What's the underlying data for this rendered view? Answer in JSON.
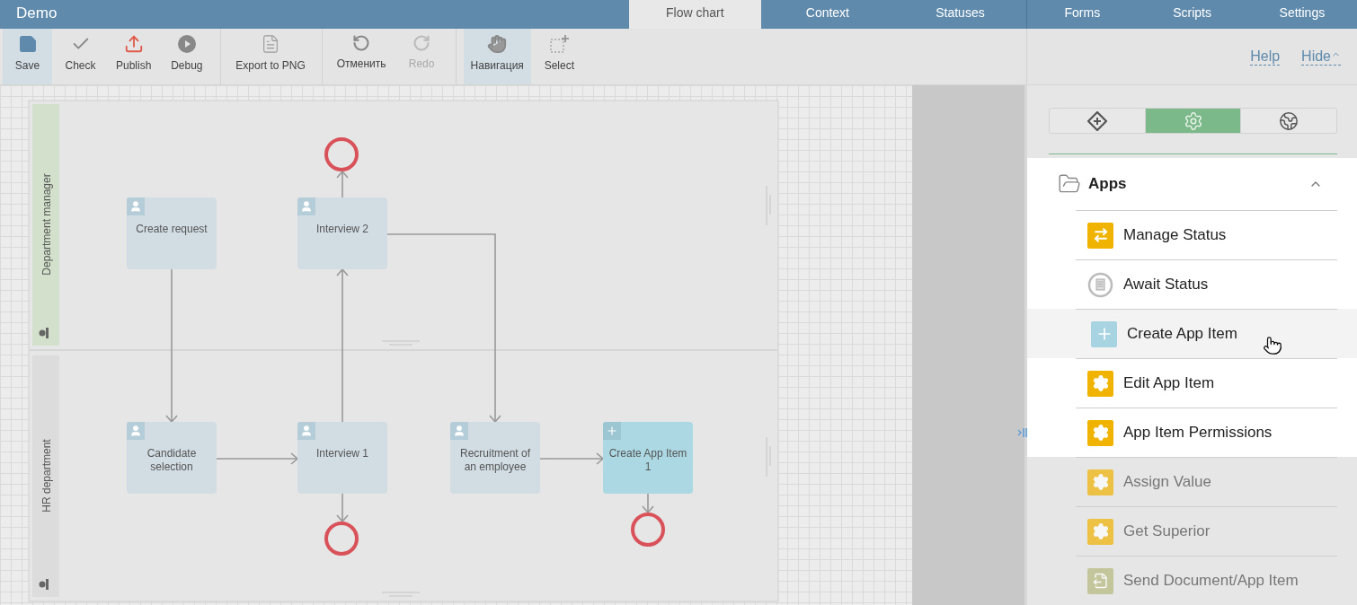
{
  "app": {
    "title": "Demo"
  },
  "tabs": [
    {
      "label": "Flow chart",
      "selected": true
    },
    {
      "label": "Context",
      "selected": false
    },
    {
      "label": "Statuses",
      "selected": false
    }
  ],
  "side_tabs": [
    {
      "label": "Forms",
      "selected": false
    },
    {
      "label": "Scripts",
      "selected": false
    },
    {
      "label": "Settings",
      "selected": false
    }
  ],
  "toolbar": {
    "groups": [
      [
        {
          "kind": "save",
          "label": "Save",
          "selected": true,
          "disabled": false
        },
        {
          "kind": "check",
          "label": "Check",
          "selected": false,
          "disabled": false
        },
        {
          "kind": "publish",
          "label": "Publish",
          "selected": false,
          "disabled": false
        },
        {
          "kind": "debug",
          "label": "Debug",
          "selected": false,
          "disabled": false
        }
      ],
      [
        {
          "kind": "export",
          "label": "Export to PNG",
          "selected": false,
          "disabled": false
        }
      ],
      [
        {
          "kind": "undo",
          "label": "Отменить",
          "selected": false,
          "disabled": false
        },
        {
          "kind": "redo",
          "label": "Redo",
          "selected": false,
          "disabled": true
        }
      ],
      [
        {
          "kind": "navigate",
          "label": "Навигация",
          "selected": true,
          "disabled": false
        },
        {
          "kind": "select",
          "label": "Select",
          "selected": false,
          "disabled": false
        }
      ]
    ],
    "links": [
      {
        "kind": "help",
        "label": "Help"
      },
      {
        "kind": "hide",
        "label": "Hide"
      }
    ]
  },
  "diagram": {
    "lanes": [
      {
        "kind": "manager",
        "label": "Department manager"
      },
      {
        "kind": "department",
        "label": "HR department"
      }
    ],
    "nodes": [
      {
        "kind": "user_task",
        "label": "Create request"
      },
      {
        "kind": "user_task",
        "label": "Interview 2"
      },
      {
        "kind": "user_task",
        "label": "Candidate selection"
      },
      {
        "kind": "user_task",
        "label": "Interview 1"
      },
      {
        "kind": "user_task",
        "label": "Recruitment of an employee"
      },
      {
        "kind": "create_task",
        "label": "Create App Item 1"
      },
      {
        "kind": "end"
      },
      {
        "kind": "end"
      },
      {
        "kind": "end"
      }
    ]
  },
  "panel": {
    "tabs": [
      {
        "kind": "elements",
        "selected": false
      },
      {
        "kind": "settings",
        "selected": true
      },
      {
        "kind": "globe",
        "selected": false
      }
    ],
    "section": {
      "label": "Apps",
      "expanded": true,
      "items": [
        {
          "kind": "status",
          "label": "Manage Status",
          "hovered": false,
          "disabled": false
        },
        {
          "kind": "await",
          "label": "Await Status",
          "hovered": false,
          "disabled": false
        },
        {
          "kind": "create",
          "label": "Create App Item",
          "hovered": true,
          "disabled": false
        },
        {
          "kind": "gear",
          "label": "Edit App Item",
          "hovered": false,
          "disabled": false
        },
        {
          "kind": "gear",
          "label": "App Item Permissions",
          "hovered": false,
          "disabled": false
        },
        {
          "kind": "gear",
          "label": "Assign Value",
          "hovered": false,
          "disabled": true
        },
        {
          "kind": "gear",
          "label": "Get Superior",
          "hovered": false,
          "disabled": true
        },
        {
          "kind": "document",
          "label": "Send Document/App Item",
          "hovered": false,
          "disabled": true
        }
      ]
    }
  }
}
